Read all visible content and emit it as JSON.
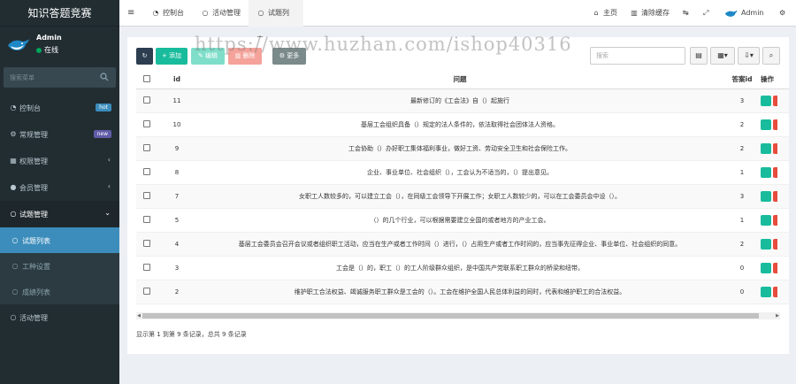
{
  "app": {
    "title": "知识答题竞赛"
  },
  "user": {
    "name": "Admin",
    "status": "在线"
  },
  "sidebar": {
    "search_placeholder": "搜索菜单",
    "items": [
      {
        "label": "控制台",
        "badge": "hot",
        "badge_color": "#3c8dbc",
        "icon": "dashboard-icon"
      },
      {
        "label": "常规管理",
        "badge": "new",
        "badge_color": "#605ca8",
        "icon": "cogs-icon"
      },
      {
        "label": "权限管理",
        "icon": "group-icon"
      },
      {
        "label": "会员管理",
        "icon": "user-icon"
      },
      {
        "label": "试题管理",
        "icon": "circle-icon"
      }
    ],
    "sub_items": [
      {
        "label": "试题列表"
      },
      {
        "label": "工种设置"
      },
      {
        "label": "成绩列表"
      }
    ],
    "last_item": {
      "label": "活动管理",
      "icon": "circle-icon"
    }
  },
  "header": {
    "tabs": [
      {
        "label": "控制台",
        "icon": "dashboard-icon"
      },
      {
        "label": "活动管理",
        "icon": "circle-icon"
      },
      {
        "label": "试题列表",
        "icon": "circle-icon"
      }
    ],
    "right": {
      "home": "主页",
      "clear_cache": "清除缓存",
      "user": "Admin"
    }
  },
  "toolbar": {
    "add": "添加",
    "edit": "编辑",
    "delete": "删除",
    "more": "更多",
    "search_placeholder": "搜索"
  },
  "watermark": "https://www.huzhan.com/ishop40316",
  "table": {
    "columns": {
      "id": "id",
      "question": "问题",
      "answer_id": "答案id",
      "actions": "操作"
    },
    "rows": [
      {
        "id": "11",
        "question": "最新修订的《工会法》自（）起施行",
        "answer_id": "3"
      },
      {
        "id": "10",
        "question": "基层工会组织具备（）规定的法人条件的，依法取得社会团体法人资格。",
        "answer_id": "2"
      },
      {
        "id": "9",
        "question": "工会协助（）办好职工集体福利事业，做好工资、劳动安全卫生和社会保险工作。",
        "answer_id": "2"
      },
      {
        "id": "8",
        "question": "企业、事业单位、社会组织（），工会认为不适当的，（）提出意见。",
        "answer_id": "1"
      },
      {
        "id": "7",
        "question": "女职工人数较多的，可以建立工会（），在同级工会领导下开展工作；女职工人数较少的，可以在工会委员会中设（）。",
        "answer_id": "3"
      },
      {
        "id": "5",
        "question": "（）的几个行业，可以根据需要建立全国的或者地方的产业工会。",
        "answer_id": "1"
      },
      {
        "id": "4",
        "question": "基层工会委员会召开会议或者组织职工活动，应当在生产或者工作时间（）进行，（）占用生产或者工作时间的，应当事先征得企业、事业单位、社会组织的同意。",
        "answer_id": "2"
      },
      {
        "id": "3",
        "question": "工会是（）的，职工（）的工人阶级群众组织，是中国共产党联系职工群众的桥梁和纽带。",
        "answer_id": "0"
      },
      {
        "id": "2",
        "question": "维护职工合法权益、竭诚服务职工群众是工会的（）。工会在维护全国人民总体利益的同时，代表和维护职工的合法权益。",
        "answer_id": "0"
      }
    ]
  },
  "pagination": {
    "info": "显示第 1 到第 9 条记录，总共 9 条记录"
  }
}
